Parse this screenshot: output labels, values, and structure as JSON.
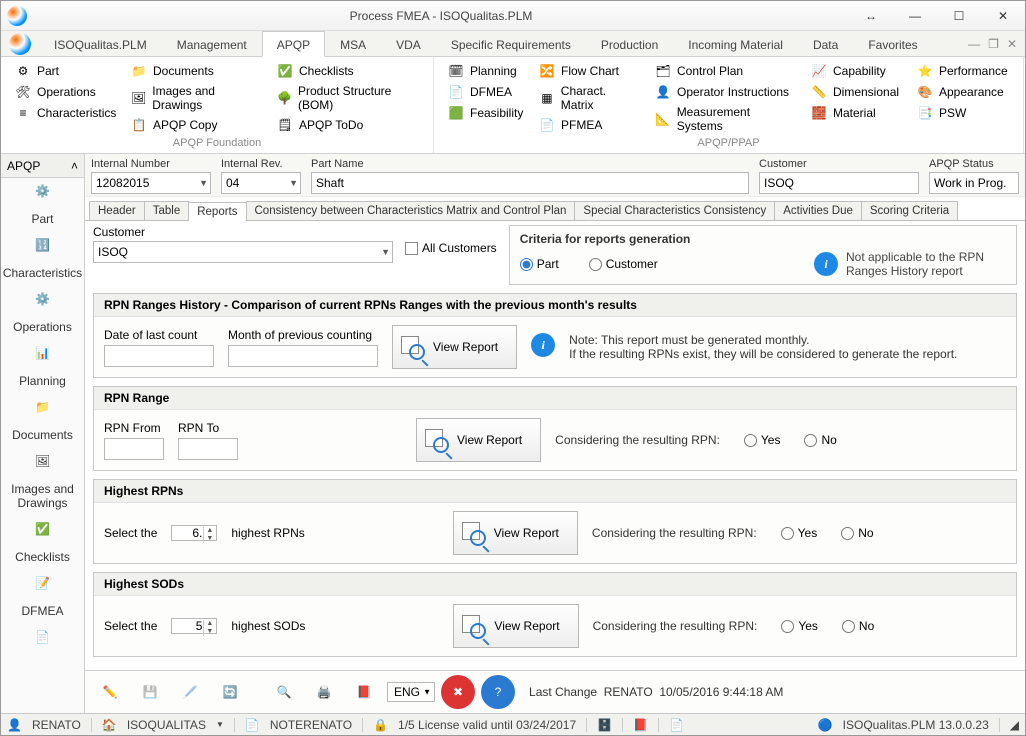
{
  "window": {
    "title": "Process FMEA - ISOQualitas.PLM"
  },
  "menuTabs": [
    "ISOQualitas.PLM",
    "Management",
    "APQP",
    "MSA",
    "VDA",
    "Specific Requirements",
    "Production",
    "Incoming Material",
    "Data",
    "Favorites"
  ],
  "activeMenuTab": 2,
  "ribbon": {
    "group1": {
      "foot": "APQP Foundation",
      "col1": [
        "Part",
        "Operations",
        "Characteristics"
      ],
      "col2": [
        "Documents",
        "Images and Drawings",
        "APQP Copy"
      ],
      "col3": [
        "Checklists",
        "Product Structure (BOM)",
        "APQP ToDo"
      ]
    },
    "group2": {
      "foot": "APQP/PPAP",
      "col1": [
        "Planning",
        "DFMEA",
        "Feasibility"
      ],
      "col2": [
        "Flow Chart",
        "Charact. Matrix",
        "PFMEA"
      ],
      "col3": [
        "Control Plan",
        "Operator Instructions",
        "Measurement Systems"
      ],
      "col4": [
        "Capability",
        "Dimensional",
        "Material"
      ],
      "col5": [
        "Performance",
        "Appearance",
        "PSW"
      ]
    }
  },
  "side": {
    "title": "APQP",
    "items": [
      "Part",
      "Characteristics",
      "Operations",
      "Planning",
      "Documents",
      "Images and Drawings",
      "Checklists",
      "DFMEA"
    ]
  },
  "header": {
    "internalNumberLabel": "Internal Number",
    "internalNumber": "12082015",
    "internalRevLabel": "Internal Rev.",
    "internalRev": "04",
    "partNameLabel": "Part Name",
    "partName": "Shaft",
    "customerLabel": "Customer",
    "customer": "ISOQ",
    "statusLabel": "APQP Status",
    "status": "Work in Prog."
  },
  "tabs": [
    "Header",
    "Table",
    "Reports",
    "Consistency between Characteristics Matrix and Control Plan",
    "Special Characteristics Consistency",
    "Activities Due",
    "Scoring Criteria"
  ],
  "activeTab": 2,
  "reports": {
    "customerLabel": "Customer",
    "customer": "ISOQ",
    "allCustomers": "All Customers",
    "criteriaTitle": "Criteria for reports generation",
    "radioPart": "Part",
    "radioCustomer": "Customer",
    "criteriaNote": "Not applicable to the RPN Ranges History report",
    "p1": {
      "title": "RPN Ranges History - Comparison of current RPNs Ranges with the previous month's results",
      "lastCount": "Date of last count",
      "prevMonth": "Month of previous counting",
      "note": "Note: This report must be generated monthly.\nIf the resulting RPNs exist, they will be considered to generate the report."
    },
    "p2": {
      "title": "RPN Range",
      "from": "RPN From",
      "to": "RPN To"
    },
    "p3": {
      "title": "Highest RPNs",
      "selectThe": "Select the",
      "value": "6.",
      "suffix": "highest RPNs"
    },
    "p4": {
      "title": "Highest SODs",
      "selectThe": "Select the",
      "value": "5",
      "suffix": "highest SODs"
    },
    "considering": "Considering the resulting RPN:",
    "yes": "Yes",
    "no": "No",
    "viewReport": "View Report"
  },
  "toolbar2": {
    "lang": "ENG",
    "lastChange": "Last Change",
    "user": "RENATO",
    "timestamp": "10/05/2016 9:44:18 AM"
  },
  "status": {
    "user": "RENATO",
    "co": "ISOQUALITAS",
    "note": "NOTERENATO",
    "lic": "1/5 License valid until 03/24/2017",
    "ver": "ISOQualitas.PLM 13.0.0.23"
  }
}
